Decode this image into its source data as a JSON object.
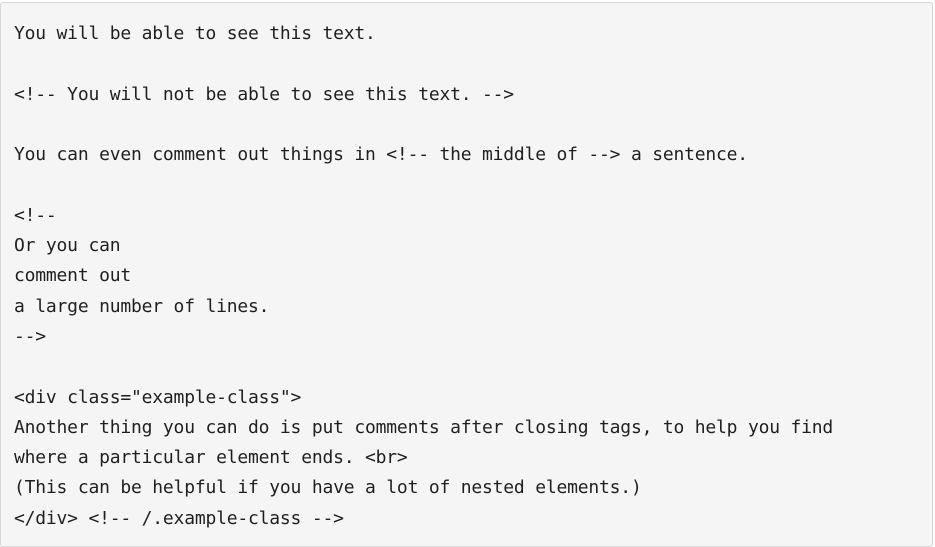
{
  "code": {
    "lines": [
      "You will be able to see this text.",
      "",
      "<!-- You will not be able to see this text. -->",
      "",
      "You can even comment out things in <!-- the middle of --> a sentence.",
      "",
      "<!--",
      "Or you can",
      "comment out",
      "a large number of lines.",
      "-->",
      "",
      "<div class=\"example-class\">",
      "Another thing you can do is put comments after closing tags, to help you find",
      "where a particular element ends. <br>",
      "(This can be helpful if you have a lot of nested elements.)",
      "</div> <!-- /.example-class -->"
    ]
  }
}
